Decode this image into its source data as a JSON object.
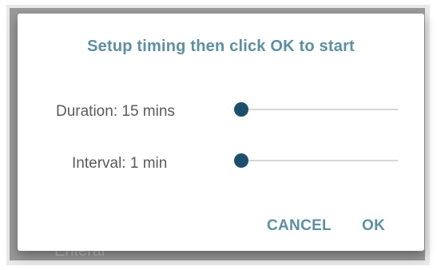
{
  "dialog": {
    "title": "Setup timing then click OK to start",
    "duration": {
      "label": "Duration: 15 mins",
      "slider_fraction": 0.0
    },
    "interval": {
      "label": "Interval: 1 min",
      "slider_fraction": 0.0
    },
    "buttons": {
      "cancel": "CANCEL",
      "ok": "OK"
    }
  },
  "background": {
    "partial_text": "Enteral"
  },
  "colors": {
    "accent": "#5e8ea2",
    "slider_thumb": "#1c4f6c",
    "slider_track": "#d6d6d6",
    "label_text": "#5a5a5a"
  }
}
